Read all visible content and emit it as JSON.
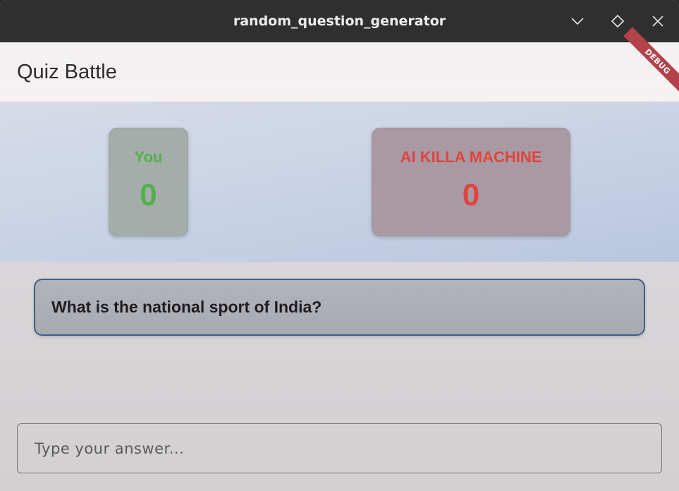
{
  "window": {
    "title": "random_question_generator",
    "controls": {
      "minimize_icon": "chevron-down-icon",
      "maximize_icon": "diamond-icon",
      "close_icon": "close-icon"
    }
  },
  "appbar": {
    "title": "Quiz Battle",
    "debug_banner": "DEBUG"
  },
  "scores": {
    "player": {
      "label": "You",
      "value": "0",
      "color": "#54b04e"
    },
    "ai": {
      "label": "AI KILLA MACHINE",
      "value": "0",
      "color": "#e0443e"
    }
  },
  "question": {
    "text": "What is the national sport of India?",
    "border_color": "#3d5f86"
  },
  "answer": {
    "placeholder": "Type your answer...",
    "value": ""
  }
}
